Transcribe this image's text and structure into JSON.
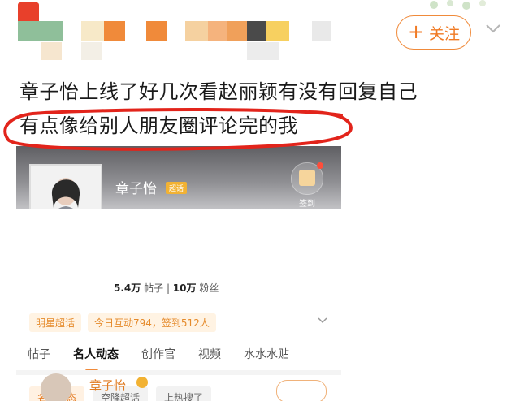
{
  "header": {
    "follow_button": {
      "label": "关注",
      "plus_icon": "plus-icon"
    },
    "dropdown_icon": "chevron-down-icon"
  },
  "post": {
    "lines": [
      "章子怡上线了好几次看赵丽颖有没有回复自己",
      "有点像给别人朋友圈评论完的我"
    ]
  },
  "embedded_profile": {
    "name": "章子怡",
    "badge": "超话",
    "checkin_label": "签到",
    "stats": {
      "posts_value": "5.4万",
      "posts_label": "帖子",
      "fans_value": "10万",
      "fans_label": "粉丝"
    },
    "chips": [
      "明星超话",
      "今日互动794，签到512人"
    ],
    "tabs": [
      "帖子",
      "名人动态",
      "创作官",
      "视频",
      "水水水贴"
    ],
    "active_tab": "名人动态",
    "sub_chips": [
      "名人动态",
      "空降超话",
      "上热搜了"
    ],
    "comment_author": "章子怡"
  },
  "colors": {
    "accent": "#f07a24",
    "highlight_circle": "#e2241b"
  }
}
